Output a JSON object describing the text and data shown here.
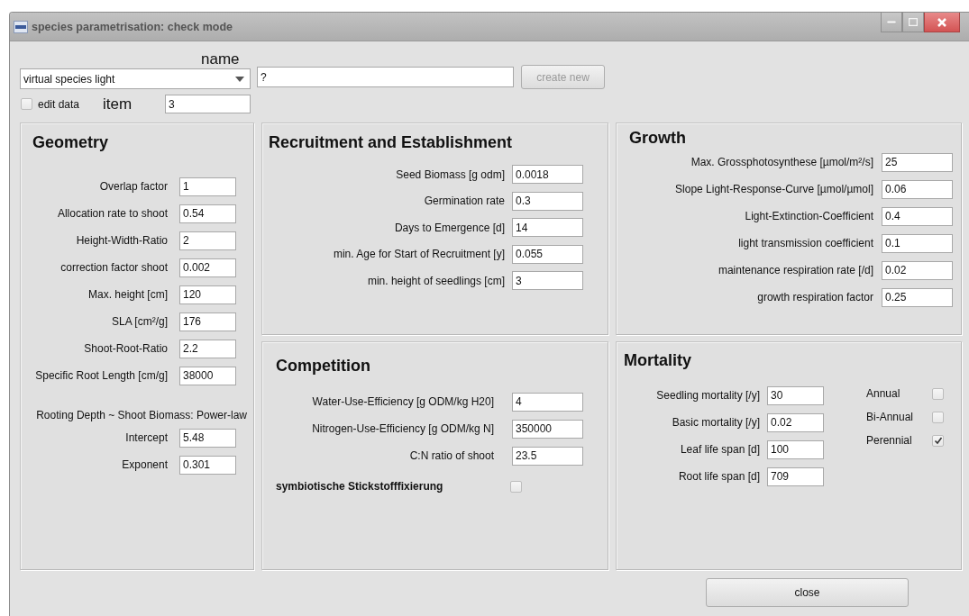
{
  "window": {
    "title": "species parametrisation: check mode"
  },
  "header": {
    "name_label": "name",
    "species": "virtual species light",
    "name_value": "?",
    "create_button": {
      "label": "create new",
      "disabled": true
    },
    "edit_data": {
      "label": "edit data",
      "checked": false
    },
    "item_label": "item",
    "item_value": "3"
  },
  "geometry": {
    "title": "Geometry",
    "fields": [
      {
        "label": "Overlap factor",
        "value": "1"
      },
      {
        "label": "Allocation rate to shoot",
        "value": "0.54"
      },
      {
        "label": "Height-Width-Ratio",
        "value": "2"
      },
      {
        "label": "correction factor shoot",
        "value": "0.002"
      },
      {
        "label": "Max. height [cm]",
        "value": "120"
      },
      {
        "label": "SLA [cm²/g]",
        "value": "176"
      },
      {
        "label": "Shoot-Root-Ratio",
        "value": "2.2"
      },
      {
        "label": "Specific Root Length [cm/g]",
        "value": "38000"
      }
    ],
    "powerlaw_caption": "Rooting Depth ~ Shoot Biomass: Power-law",
    "powerlaw_fields": [
      {
        "label": "Intercept",
        "value": "5.48"
      },
      {
        "label": "Exponent",
        "value": "0.301"
      }
    ]
  },
  "recruitment": {
    "title": "Recruitment and Establishment",
    "fields": [
      {
        "label": "Seed Biomass [g odm]",
        "value": "0.0018"
      },
      {
        "label": "Germination rate",
        "value": "0.3"
      },
      {
        "label": "Days to Emergence [d]",
        "value": "14"
      },
      {
        "label": "min. Age for Start of Recruitment [y]",
        "value": "0.055"
      },
      {
        "label": "min. height of seedlings [cm]",
        "value": "3"
      }
    ]
  },
  "growth": {
    "title": "Growth",
    "fields": [
      {
        "label": "Max. Grossphotosynthese [µmol/m²/s]",
        "value": "25"
      },
      {
        "label": "Slope Light-Response-Curve [µmol/µmol]",
        "value": "0.06"
      },
      {
        "label": "Light-Extinction-Coefficient",
        "value": "0.4"
      },
      {
        "label": "light transmission coefficient",
        "value": "0.1"
      },
      {
        "label": "maintenance respiration rate [/d]",
        "value": "0.02"
      },
      {
        "label": "growth respiration factor",
        "value": "0.25"
      }
    ]
  },
  "competition": {
    "title": "Competition",
    "fields": [
      {
        "label": "Water-Use-Efficiency [g ODM/kg H20]",
        "value": "4"
      },
      {
        "label": "Nitrogen-Use-Efficiency [g ODM/kg N]",
        "value": "350000"
      },
      {
        "label": "C:N ratio of shoot",
        "value": "23.5"
      }
    ],
    "option": {
      "label": "symbiotische Stickstofffixierung",
      "checked": false
    }
  },
  "mortality": {
    "title": "Mortality",
    "fields": [
      {
        "label": "Seedling mortality [/y]",
        "value": "30"
      },
      {
        "label": "Basic mortality [/y]",
        "value": "0.02"
      },
      {
        "label": "Leaf life span [d]",
        "value": "100"
      },
      {
        "label": "Root life span [d]",
        "value": "709"
      }
    ],
    "life_forms": [
      {
        "label": "Annual",
        "checked": false
      },
      {
        "label": "Bi-Annual",
        "checked": false
      },
      {
        "label": "Perennial",
        "checked": true
      }
    ]
  },
  "close_button": "close"
}
